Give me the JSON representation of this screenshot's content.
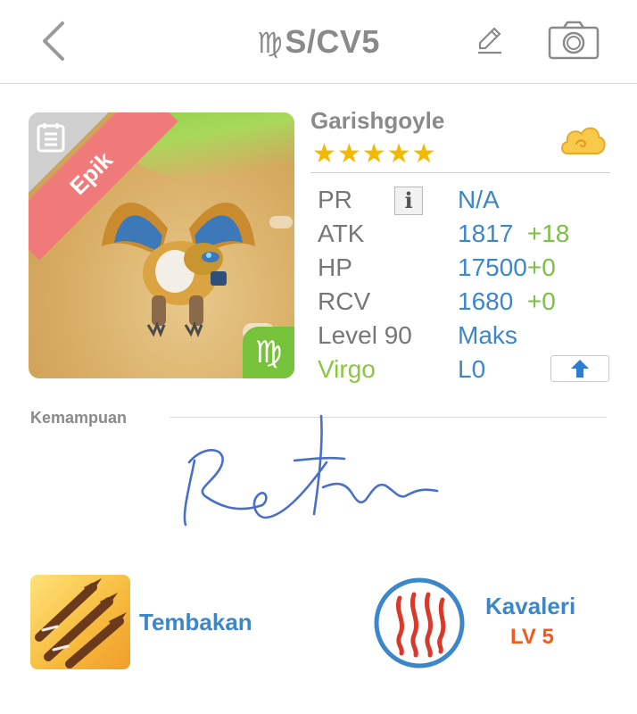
{
  "header": {
    "zodiac_symbol": "♍",
    "title": "S/CV5",
    "icons": [
      "chevron-left-icon",
      "pencil-icon",
      "camera-icon"
    ]
  },
  "card": {
    "rarity": "Epik",
    "element_symbol": "♍",
    "accent_colors": {
      "ribbon": "#f07a7a",
      "badge": "#76c23a"
    }
  },
  "monster": {
    "name": "Garishgoyle",
    "stars": "★★★★★",
    "star_count": 5
  },
  "stats": {
    "pr": {
      "label": "PR",
      "value": "N/A"
    },
    "atk": {
      "label": "ATK",
      "value": "1817",
      "bonus": "+18"
    },
    "hp": {
      "label": "HP",
      "value": "17500",
      "bonus": "+0"
    },
    "rcv": {
      "label": "RCV",
      "value": "1680",
      "bonus": "+0"
    },
    "level": {
      "label": "Level 90",
      "value": "Maks"
    },
    "zodiac": {
      "label": "Virgo",
      "value": "L0"
    }
  },
  "ability": {
    "section_label": "Kemampuan"
  },
  "skill": {
    "name": "Tembakan"
  },
  "class": {
    "name": "Kavaleri",
    "level": "LV 5"
  },
  "colors": {
    "value_blue": "#3b87c9",
    "bonus_green": "#7ac144",
    "star_gold": "#f5b800",
    "level_orange": "#f05a1a"
  }
}
